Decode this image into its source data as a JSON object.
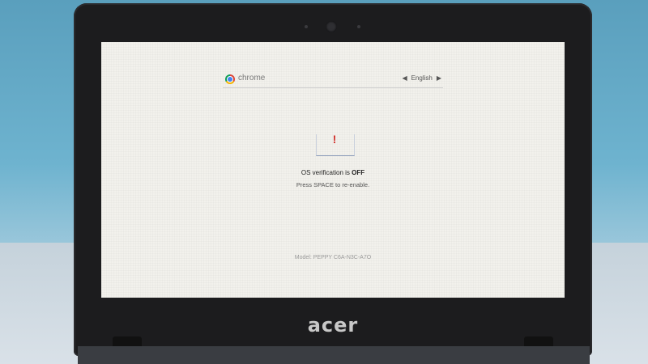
{
  "screen": {
    "brand_name": "chrome",
    "language": {
      "prev_arrow": "◀",
      "current": "English",
      "next_arrow": "▶"
    },
    "warning_glyph": "!",
    "status_prefix": "OS verification is ",
    "status_state": "OFF",
    "hint": "Press SPACE to re-enable.",
    "model": "Model: PEPPY C6A-N3C-A7O"
  },
  "device": {
    "logo_text": "acer"
  },
  "icons": {
    "browser_logo": "chrome-logo-icon",
    "warning": "exclamation-icon",
    "lang_prev": "triangle-left-icon",
    "lang_next": "triangle-right-icon",
    "webcam": "webcam-icon"
  },
  "colors": {
    "warning": "#d0312d",
    "screen_bg": "#f2f1ec",
    "bezel": "#1c1c1e"
  }
}
